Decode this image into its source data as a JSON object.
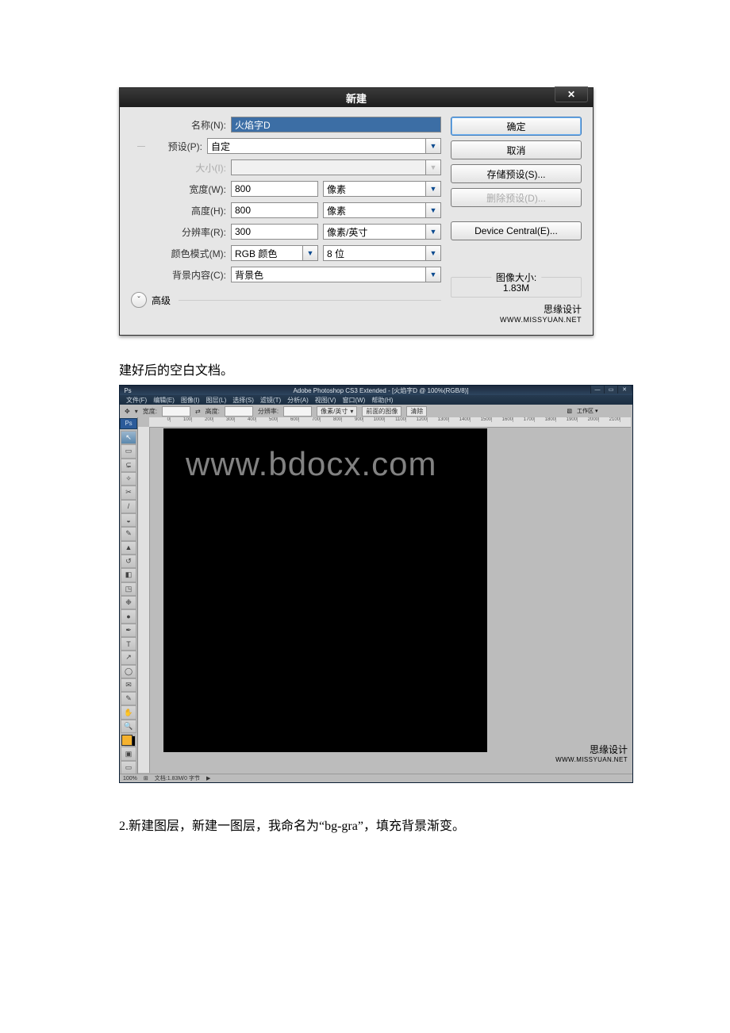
{
  "dialog": {
    "title": "新建",
    "close": "✕",
    "name_label": "名称(N):",
    "name_value": "火焰字D",
    "preset_label": "预设(P):",
    "preset_value": "自定",
    "size_label": "大小(I):",
    "width_label": "宽度(W):",
    "width_value": "800",
    "width_unit": "像素",
    "height_label": "高度(H):",
    "height_value": "800",
    "height_unit": "像素",
    "res_label": "分辨率(R):",
    "res_value": "300",
    "res_unit": "像素/英寸",
    "mode_label": "颜色模式(M):",
    "mode_value": "RGB 颜色",
    "bit_value": "8 位",
    "bg_label": "背景内容(C):",
    "bg_value": "背景色",
    "advanced": "高级",
    "adv_glyph": "ˇ",
    "ok": "确定",
    "cancel": "取消",
    "save_preset": "存储预设(S)...",
    "delete_preset": "删除预设(D)...",
    "device_central": "Device Central(E)...",
    "image_size_title": "图像大小:",
    "image_size_value": "1.83M",
    "credit": "思缘设计",
    "credit_url": "WWW.MISSYUAN.NET"
  },
  "caption1": "建好后的空白文档。",
  "ps": {
    "title_center": "Adobe Photoshop CS3 Extended - [火焰字D @ 100%(RGB/8)]",
    "menus": [
      "文件(F)",
      "编辑(E)",
      "图像(I)",
      "图层(L)",
      "选择(S)",
      "滤镜(T)",
      "分析(A)",
      "视图(V)",
      "窗口(W)",
      "帮助(H)"
    ],
    "options": {
      "tool_glyph": "✥",
      "width_label": "宽度:",
      "height_label": "高度:",
      "res_label": "分辨率:",
      "res_unit": "像素/英寸",
      "front_image": "前面的图像",
      "clear": "清除",
      "workspace": "工作区 ▾",
      "icon_name": "workspace-icon"
    },
    "watermark": "www.bdocx.com",
    "credit": "思缘设计",
    "credit_url": "WWW.MISSYUAN.NET",
    "status": {
      "zoom": "100%",
      "doc": "文档:1.83M/0 字节",
      "arrow": "▶"
    }
  },
  "step2": "2.新建图层，新建一图层，我命名为“bg-gra”，填充背景渐变。"
}
